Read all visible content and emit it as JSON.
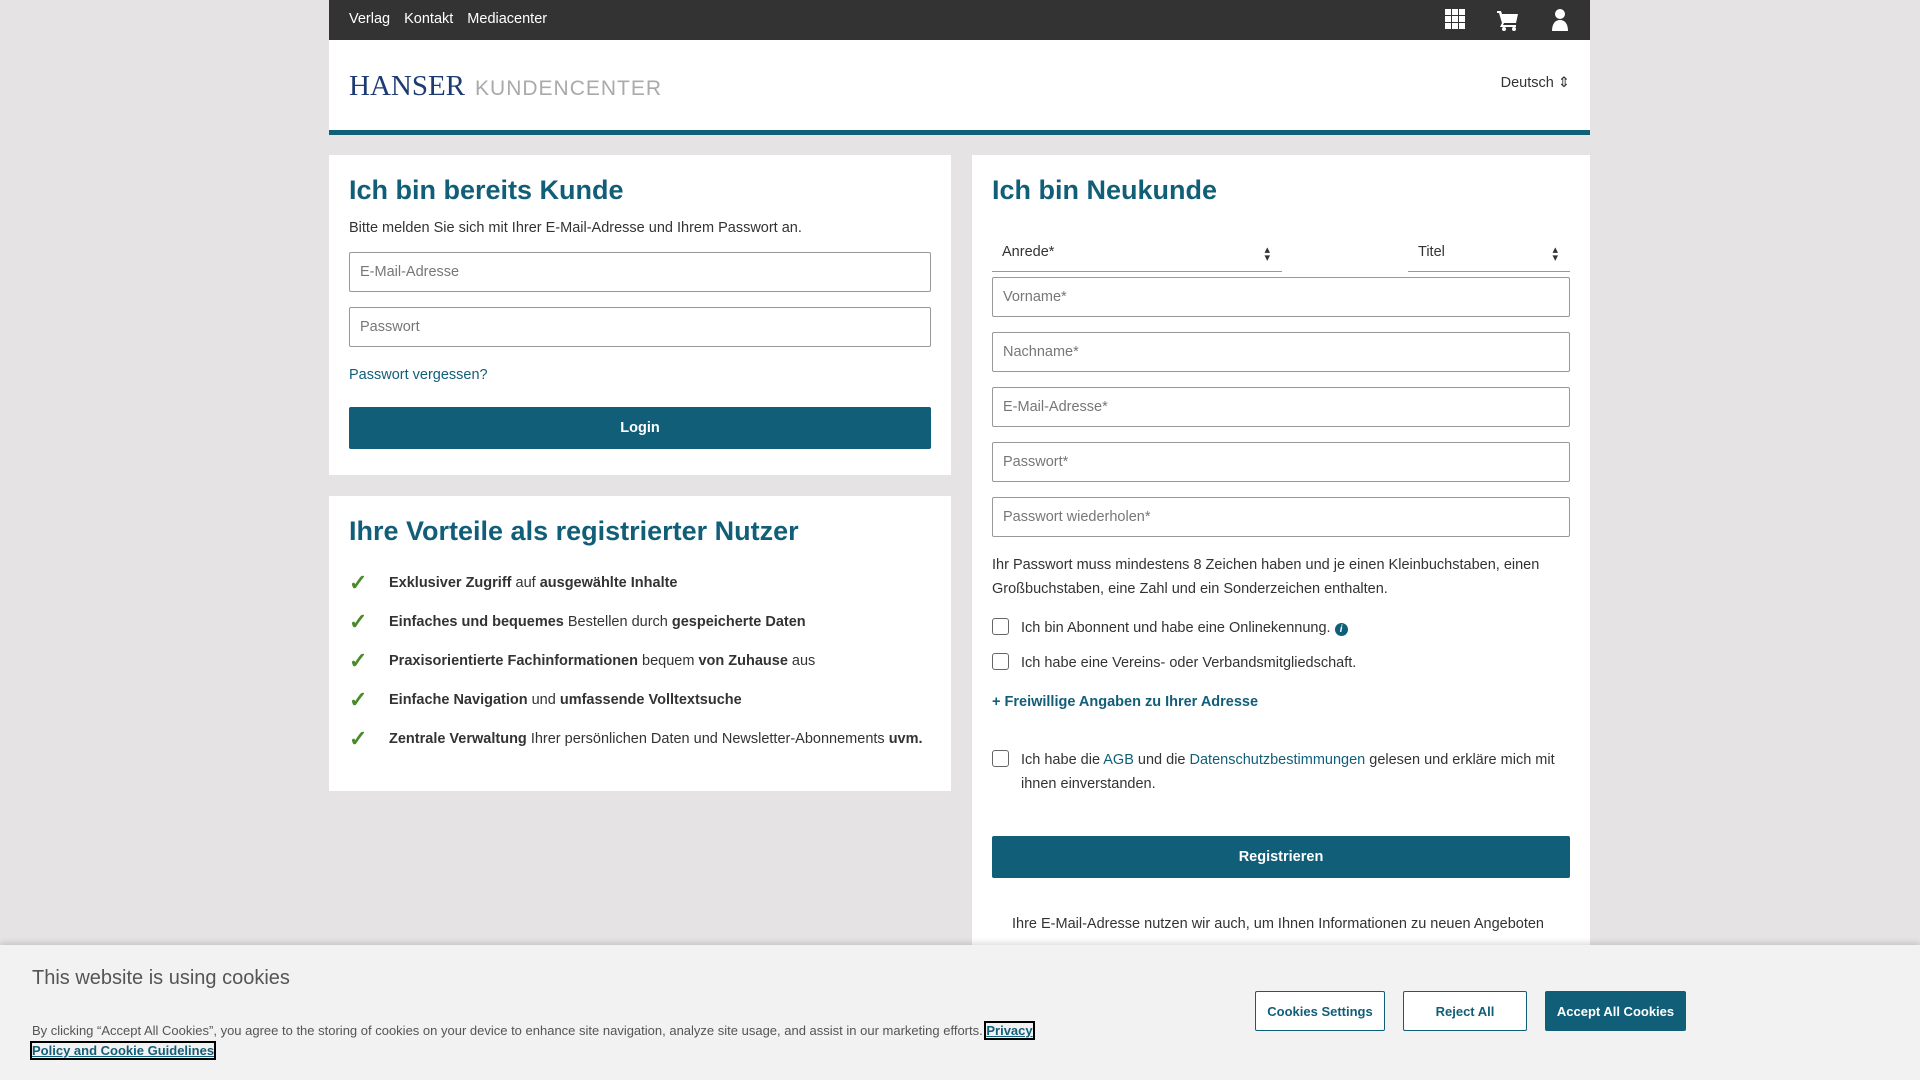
{
  "topbar": {
    "nav": [
      "Verlag",
      "Kontakt",
      "Mediacenter"
    ],
    "icons": [
      "grid-icon",
      "cart-icon",
      "user-icon"
    ]
  },
  "header": {
    "logo_brand": "HANSER",
    "logo_sub": "KUNDENCENTER",
    "language": "Deutsch"
  },
  "login": {
    "title": "Ich bin bereits Kunde",
    "intro": "Bitte melden Sie sich mit Ihrer E-Mail-Adresse und Ihrem Passwort an.",
    "email_placeholder": "E-Mail-Adresse",
    "password_placeholder": "Passwort",
    "forgot": "Passwort vergessen?",
    "button": "Login"
  },
  "benefits": {
    "title": "Ihre Vorteile als registrierter Nutzer",
    "items": [
      [
        {
          "t": "Exklusiver Zugriff",
          "b": true
        },
        {
          "t": " auf ",
          "b": false
        },
        {
          "t": "ausgewählte Inhalte",
          "b": true
        }
      ],
      [
        {
          "t": "Einfaches und bequemes",
          "b": true
        },
        {
          "t": " Bestellen durch ",
          "b": false
        },
        {
          "t": "gespeicherte Daten",
          "b": true
        }
      ],
      [
        {
          "t": "Praxisorientierte Fachinformationen",
          "b": true
        },
        {
          "t": " bequem ",
          "b": false
        },
        {
          "t": "von Zuhause",
          "b": true
        },
        {
          "t": " aus",
          "b": false
        }
      ],
      [
        {
          "t": "Einfache Navigation",
          "b": true
        },
        {
          "t": " und ",
          "b": false
        },
        {
          "t": "umfassende Volltextsuche",
          "b": true
        }
      ],
      [
        {
          "t": "Zentrale Verwaltung",
          "b": true
        },
        {
          "t": " Ihrer persönlichen Daten und Newsletter-Abonnements ",
          "b": false
        },
        {
          "t": "uvm.",
          "b": true
        }
      ]
    ]
  },
  "register": {
    "title": "Ich bin Neukunde",
    "salutation": "Anrede*",
    "title_select": "Titel",
    "fields": [
      "Vorname*",
      "Nachname*",
      "E-Mail-Adresse*",
      "Passwort*",
      "Passwort wiederholen*"
    ],
    "password_hint": "Ihr Passwort muss mindestens 8 Zeichen haben und je einen Kleinbuchstaben, einen Großbuchstaben, eine Zahl und ein Sonderzeichen enthalten.",
    "cb_subscriber": "Ich bin Abonnent und habe eine Onlinekennung.",
    "cb_member": "Ich habe eine Vereins- oder Verbandsmitgliedschaft.",
    "optional": "Freiwillige Angaben zu Ihrer Adresse",
    "agb_pre": "Ich habe die ",
    "agb": "AGB",
    "agb_mid": " und die ",
    "privacy": "Datenschutzbestimmungen",
    "agb_post": " gelesen und erkläre mich mit ihnen einverstanden.",
    "button": "Registrieren",
    "footnote": "Ihre E-Mail-Adresse nutzen wir auch, um Ihnen Informationen zu neuen Angeboten"
  },
  "cookie": {
    "title": "This website is using cookies",
    "text": "By clicking “Accept All Cookies”, you agree to the storing of cookies on your device to enhance site navigation, analyze site usage, and assist in our marketing efforts.",
    "link": "Privacy Policy and Cookie Guidelines",
    "settings": "Cookies Settings",
    "reject": "Reject All",
    "accept": "Accept All Cookies"
  },
  "colors": {
    "brand": "#115e78",
    "check": "#4a8a2a",
    "topbar": "#333333"
  }
}
